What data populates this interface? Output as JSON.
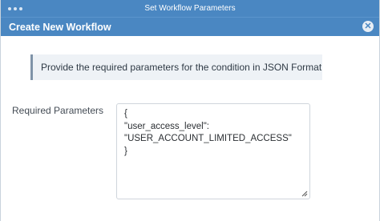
{
  "window": {
    "title": "Set Workflow Parameters"
  },
  "dialog": {
    "title": "Create New Workflow"
  },
  "info": {
    "message": "Provide the required parameters for the condition in JSON Format"
  },
  "form": {
    "label": "Required Parameters",
    "value_lines": [
      "{",
      "\"user_access_level\":",
      "\"USER_ACCOUNT_LIMITED_ACCESS\"",
      "}"
    ]
  },
  "colors": {
    "accent": "#4a87c2",
    "info_bg": "#eef2f6",
    "info_border": "#7f93a8"
  },
  "icons": {
    "close": "close-icon",
    "resize": "resize-grip-icon"
  }
}
